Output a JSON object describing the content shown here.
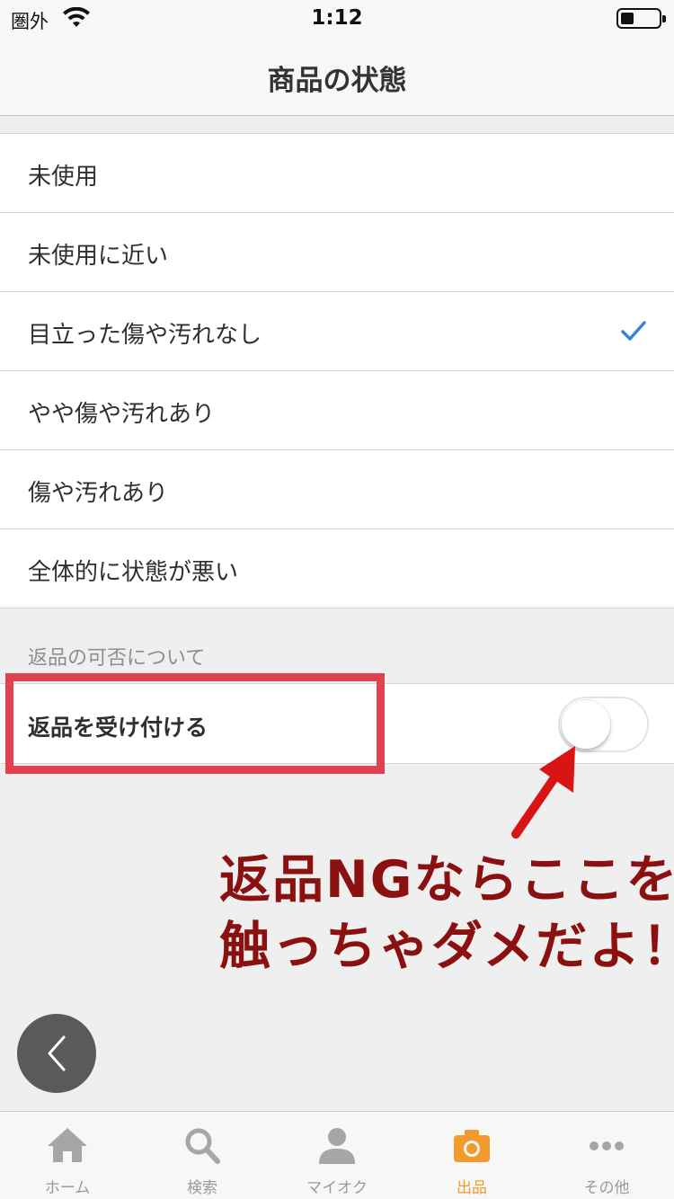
{
  "status_bar": {
    "carrier": "圏外",
    "time": "1:12"
  },
  "nav": {
    "title": "商品の状態"
  },
  "options": [
    {
      "label": "未使用",
      "selected": false
    },
    {
      "label": "未使用に近い",
      "selected": false
    },
    {
      "label": "目立った傷や汚れなし",
      "selected": true
    },
    {
      "label": "やや傷や汚れあり",
      "selected": false
    },
    {
      "label": "傷や汚れあり",
      "selected": false
    },
    {
      "label": "全体的に状態が悪い",
      "selected": false
    }
  ],
  "returns_section": {
    "header": "返品の可否について",
    "label": "返品を受け付ける",
    "toggle_on": false
  },
  "annotation": {
    "line1": "返品NGならここを",
    "line2": "触っちゃダメだよ！"
  },
  "tabs": [
    {
      "label": "ホーム",
      "icon": "home-icon",
      "active": false
    },
    {
      "label": "検索",
      "icon": "search-icon",
      "active": false
    },
    {
      "label": "マイオク",
      "icon": "person-icon",
      "active": false
    },
    {
      "label": "出品",
      "icon": "camera-icon",
      "active": true
    },
    {
      "label": "その他",
      "icon": "more-icon",
      "active": false
    }
  ],
  "colors": {
    "accent_check": "#3b82d6",
    "tab_active": "#f29b2c",
    "highlight": "#e0424f",
    "annotation_text": "#8b1111",
    "arrow": "#d91414"
  }
}
